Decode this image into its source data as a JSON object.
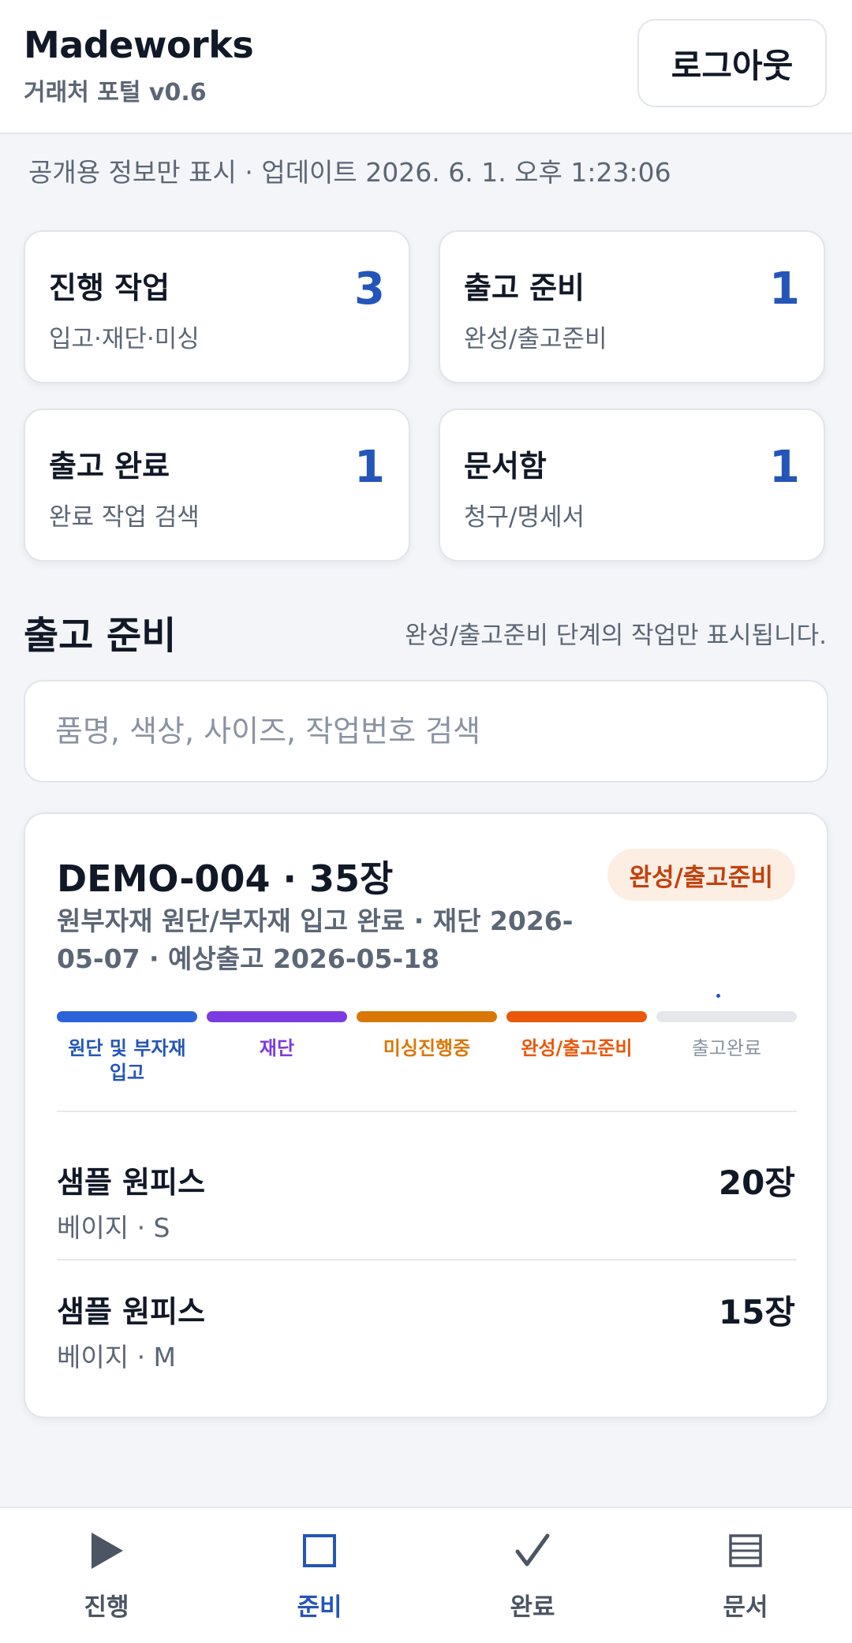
{
  "header": {
    "brand": "Madeworks",
    "subtitle": "거래처 포털 v0.6",
    "logout_label": "로그아웃"
  },
  "notice": "공개용 정보만 표시 · 업데이트 2026. 6. 1. 오후 1:23:06",
  "stats": [
    {
      "title": "진행 작업",
      "sub": "입고·재단·미싱",
      "count": "3"
    },
    {
      "title": "출고 준비",
      "sub": "완성/출고준비",
      "count": "1"
    },
    {
      "title": "출고 완료",
      "sub": "완료 작업 검색",
      "count": "1"
    },
    {
      "title": "문서함",
      "sub": "청구/명세서",
      "count": "1"
    }
  ],
  "section": {
    "title": "출고 준비",
    "desc": "완성/출고준비 단계의 작업만 표시됩니다."
  },
  "search": {
    "placeholder": "품명, 색상, 사이즈, 작업번호 검색",
    "value": ""
  },
  "job": {
    "title": "DEMO-004 · 35장",
    "badge": "완성/출고준비",
    "meta": "원부자재 원단/부자재 입고 완료 · 재단 2026-05-07 · 예상출고 2026-05-18",
    "stages": [
      {
        "label": "원단 및 부자재 입고",
        "color": "#2b63d9",
        "label_color": "#2456b8",
        "done": true
      },
      {
        "label": "재단",
        "color": "#7c3ae0",
        "label_color": "#7c3ae0",
        "done": true
      },
      {
        "label": "미싱진행중",
        "color": "#d97706",
        "label_color": "#d97706",
        "done": true
      },
      {
        "label": "완성/출고준비",
        "color": "#ea580c",
        "label_color": "#ea580c",
        "done": true
      },
      {
        "label": "출고완료",
        "color": "#e5e7eb",
        "label_color": "#8a93a3",
        "done": false
      }
    ],
    "items": [
      {
        "name": "샘플 원피스",
        "sub": "베이지 · S",
        "qty": "20장"
      },
      {
        "name": "샘플 원피스",
        "sub": "베이지 · M",
        "qty": "15장"
      }
    ]
  },
  "nav": [
    {
      "label": "진행",
      "icon": "play-icon",
      "active": false
    },
    {
      "label": "준비",
      "icon": "square-icon",
      "active": true
    },
    {
      "label": "완료",
      "icon": "check-icon",
      "active": false
    },
    {
      "label": "문서",
      "icon": "document-lines-icon",
      "active": false
    }
  ],
  "colors": {
    "accent": "#2456b8",
    "badge_bg": "#fdeee4",
    "badge_text": "#c2410c"
  }
}
